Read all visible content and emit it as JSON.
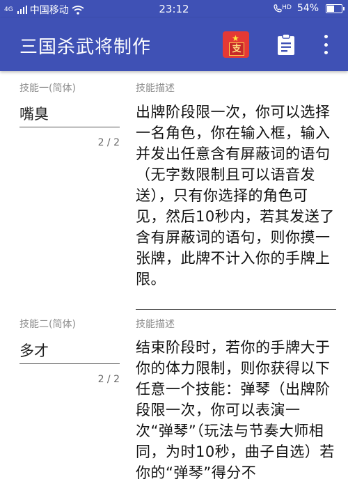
{
  "status_bar": {
    "signal_label": "4G",
    "carrier": "中国移动",
    "time": "23:12",
    "call_label": "HD",
    "battery_percent": "54%",
    "battery_level": 0.54
  },
  "app_bar": {
    "title": "三国杀武将制作",
    "action_icon_text": "支"
  },
  "skills": [
    {
      "name_label": "技能一(简体)",
      "name_value": "嘴臭",
      "counter": "2 / 2",
      "desc_label": "技能描述",
      "description": "出牌阶段限一次，你可以选择一名角色，你在输入框，输入并发出任意含有屏蔽词的语句（无字数限制且可以语音发送），只有你选择的角色可见，然后10秒内，若其发送了含有屏蔽词的语句，则你摸一张牌，此牌不计入你的手牌上限。"
    },
    {
      "name_label": "技能二(简体)",
      "name_value": "多才",
      "counter": "2 / 2",
      "desc_label": "技能描述",
      "description": "结束阶段时，若你的手牌大于你的体力限制，则你获得以下任意一个技能：弹琴（出牌阶段限一次，你可以表演一次“弹琴”（玩法与节奏大师相同，为时10秒，曲子自选）若你的“弹琴”得分不"
    }
  ],
  "colors": {
    "primary": "#3f51b5",
    "accent_red": "#e53935"
  }
}
